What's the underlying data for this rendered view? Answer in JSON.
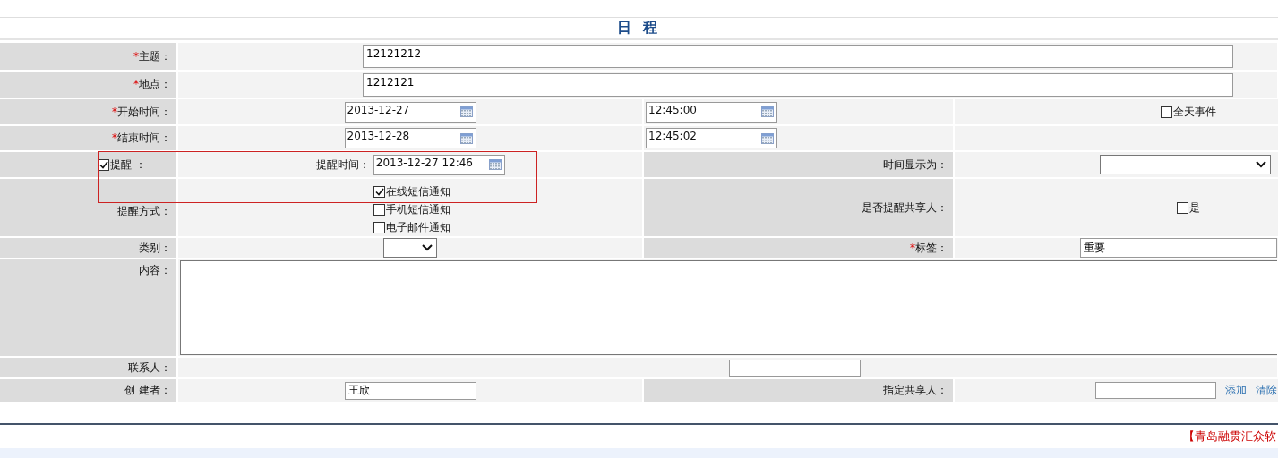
{
  "title": "日 程",
  "required_mark": "*",
  "subject": {
    "label": "主题：",
    "required": true,
    "value": "12121212"
  },
  "location": {
    "label": "地点：",
    "required": true,
    "value": "1212121"
  },
  "start": {
    "label": "开始时间：",
    "required": true,
    "date": "2013-12-27",
    "time": "12:45:00"
  },
  "all_day": {
    "label": "全天事件",
    "checked": false
  },
  "end": {
    "label": "结束时间：",
    "required": true,
    "date": "2013-12-28",
    "time": "12:45:02"
  },
  "reminder": {
    "label": "提醒 ：",
    "checked": true,
    "time_label": "提醒时间：",
    "time": "2013-12-27 12:46"
  },
  "time_display": {
    "label": "时间显示为："
  },
  "reminder_methods": {
    "label": "提醒方式：",
    "options": [
      {
        "label": "在线短信通知",
        "checked": true
      },
      {
        "label": "手机短信通知",
        "checked": false
      },
      {
        "label": "电子邮件通知",
        "checked": false
      }
    ]
  },
  "notify_sharers": {
    "label": "是否提醒共享人：",
    "option": {
      "label": "是",
      "checked": false
    }
  },
  "category": {
    "label": "类别："
  },
  "tag": {
    "label": "标签：",
    "required": true,
    "value": "重要"
  },
  "content": {
    "label": "内容："
  },
  "contact": {
    "label": "联系人："
  },
  "creator": {
    "label": "创 建者：",
    "value": "王欣"
  },
  "sharers": {
    "label": "指定共享人：",
    "links": [
      "添加",
      "清除"
    ]
  },
  "footer": "【青岛融贯汇众软"
}
